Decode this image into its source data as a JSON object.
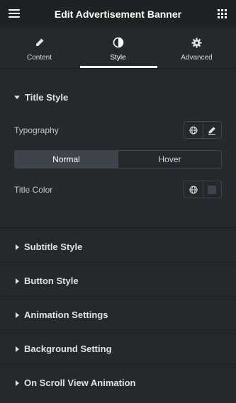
{
  "header": {
    "title": "Edit Advertisement Banner"
  },
  "tabs": [
    {
      "label": "Content",
      "icon": "pencil-icon"
    },
    {
      "label": "Style",
      "icon": "contrast-icon",
      "active": true
    },
    {
      "label": "Advanced",
      "icon": "gear-icon"
    }
  ],
  "title_style": {
    "heading": "Title Style",
    "typography_label": "Typography",
    "state_options": [
      "Normal",
      "Hover"
    ],
    "active_state": "Normal",
    "title_color_label": "Title Color"
  },
  "collapsed_sections": [
    "Subtitle Style",
    "Button Style",
    "Animation Settings",
    "Background Setting",
    "On Scroll View Animation"
  ],
  "colors": {
    "background": "#26292c",
    "header": "#1f2124",
    "border": "#3f444b",
    "text": "#e0e1e3"
  }
}
